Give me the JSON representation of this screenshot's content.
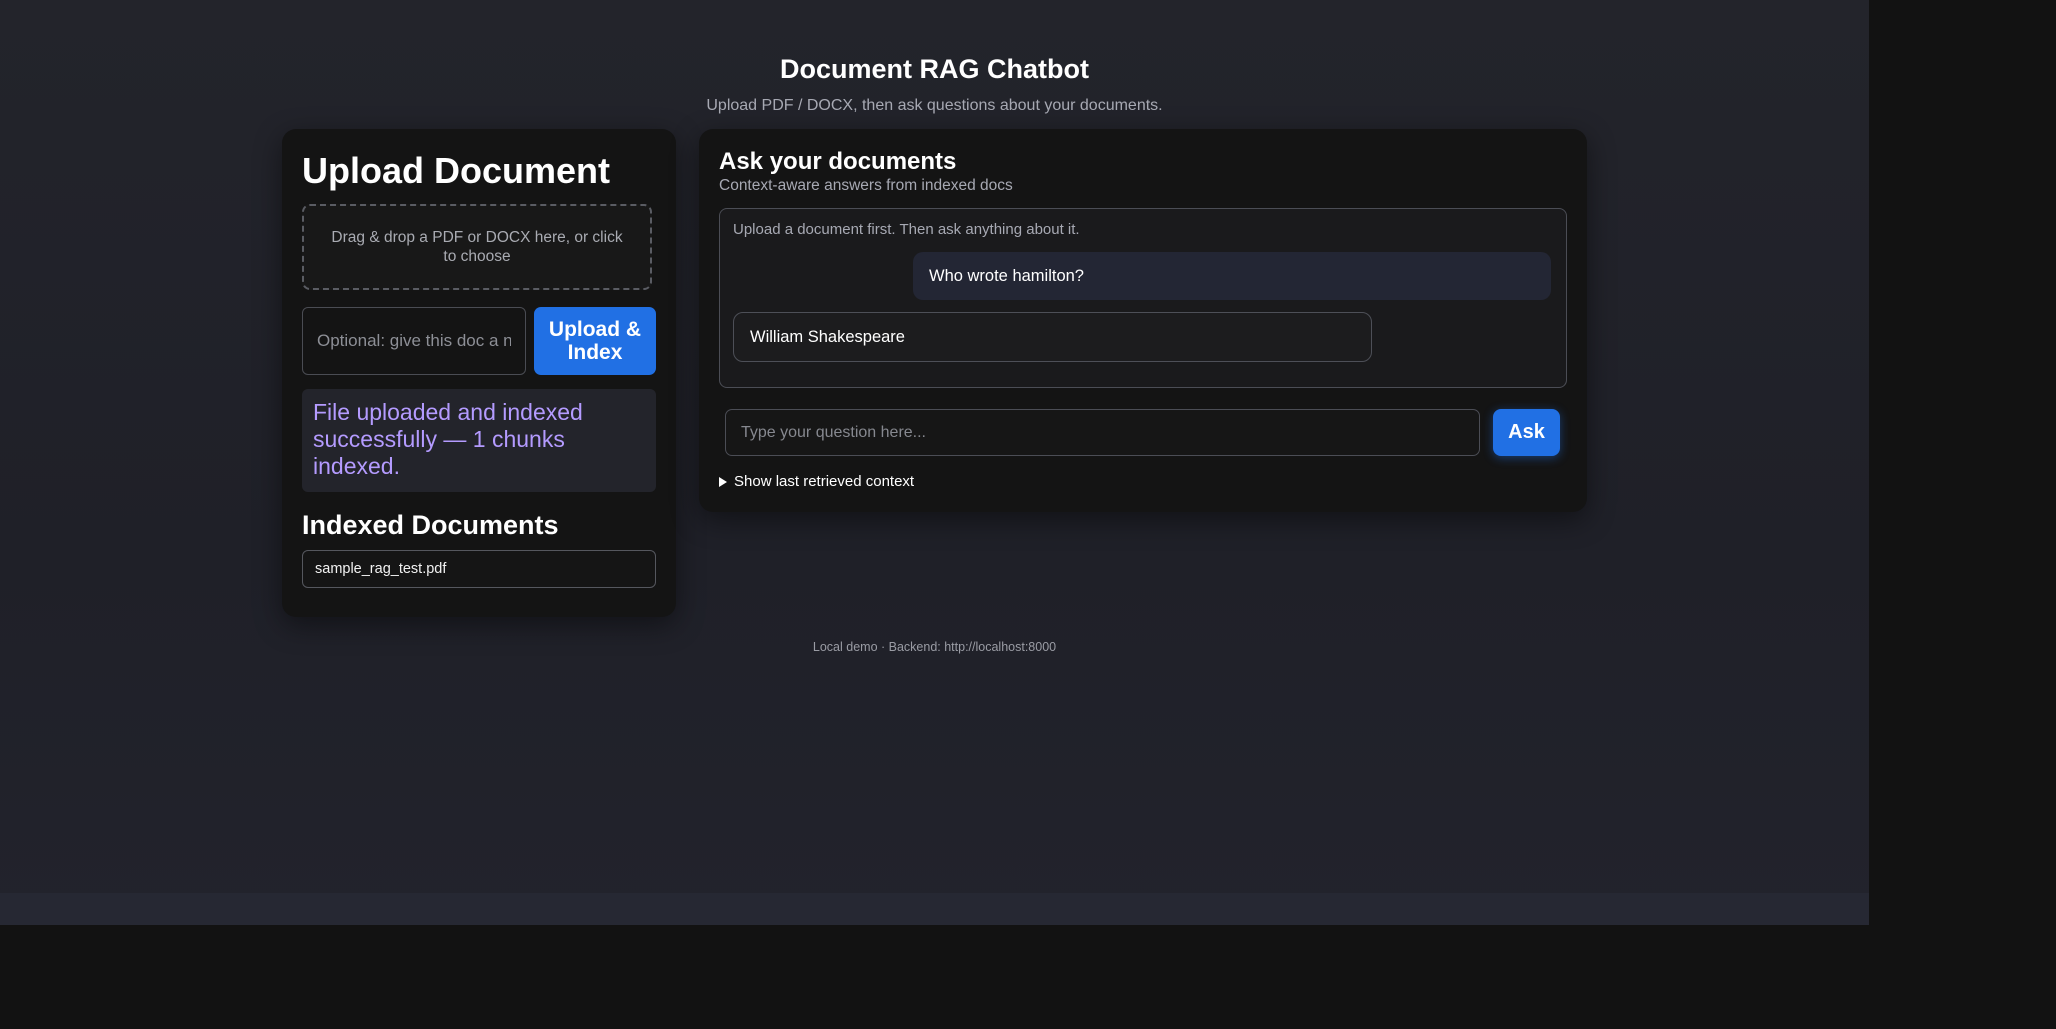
{
  "header": {
    "title": "Document RAG Chatbot",
    "subtitle": "Upload PDF / DOCX, then ask questions about your documents."
  },
  "upload": {
    "title": "Upload Document",
    "dropzone_text": "Drag & drop a PDF or DOCX here, or click to choose",
    "name_placeholder": "Optional: give this doc a name",
    "button_label": "Upload & Index",
    "status_message": "File uploaded and indexed successfully — 1 chunks indexed.",
    "indexed_title": "Indexed Documents",
    "documents": [
      {
        "name": "sample_rag_test.pdf"
      }
    ]
  },
  "chat": {
    "title": "Ask your documents",
    "subtitle": "Context-aware answers from indexed docs",
    "hint": "Upload a document first. Then ask anything about it.",
    "messages": [
      {
        "role": "user",
        "text": "Who wrote hamilton?"
      },
      {
        "role": "bot",
        "text": "William Shakespeare"
      }
    ],
    "input_placeholder": "Type your question here...",
    "ask_label": "Ask",
    "context_toggle_label": "Show last retrieved context"
  },
  "footer": {
    "text": "Local demo · Backend: http://localhost:8000"
  },
  "colors": {
    "accent": "#2170e4",
    "status_text": "#b49bff",
    "card_bg": "#141414",
    "page_bg": "#23242b"
  },
  "icons": {
    "context_toggle": "triangle-right-icon"
  }
}
